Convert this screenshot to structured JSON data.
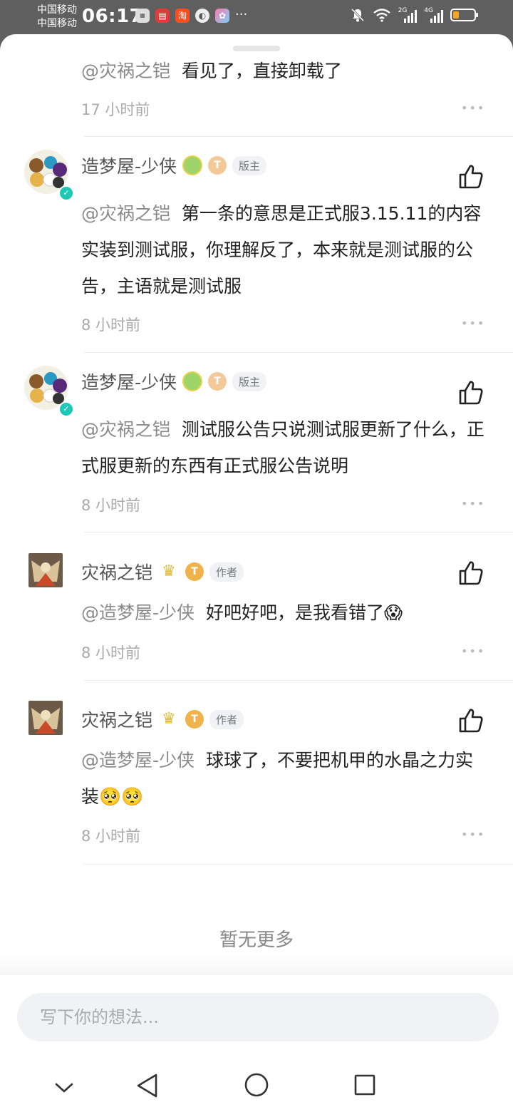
{
  "status_bar": {
    "carrier1": "中国移动",
    "carrier2": "中国移动",
    "time": "06:17",
    "net1": "2G",
    "net2": "4G",
    "dots": "···"
  },
  "comments": [
    {
      "mention": "@灾祸之铠",
      "text": "看见了，直接卸载了",
      "time": "17 小时前"
    },
    {
      "name": "造梦屋-少侠",
      "tag": "版主",
      "mention": "@灾祸之铠",
      "text": "第一条的意思是正式服3.15.11的内容实装到测试服，你理解反了，本来就是测试服的公告，主语就是测试服",
      "time": "8 小时前"
    },
    {
      "name": "造梦屋-少侠",
      "tag": "版主",
      "mention": "@灾祸之铠",
      "text": "测试服公告只说测试服更新了什么，正式服更新的东西有正式服公告说明",
      "time": "8 小时前"
    },
    {
      "name": "灾祸之铠",
      "tag": "作者",
      "mention": "@造梦屋-少侠",
      "text": "好吧好吧，是我看错了😱",
      "time": "8 小时前"
    },
    {
      "name": "灾祸之铠",
      "tag": "作者",
      "mention": "@造梦屋-少侠",
      "text": "球球了，不要把机甲的水晶之力实装🥺🥺",
      "time": "8 小时前"
    }
  ],
  "footer": {
    "no_more": "暂无更多",
    "input_placeholder": "写下你的想法..."
  },
  "badge_letter": "T",
  "more_glyph": "•••",
  "icons": {
    "like": "thumbs-up-icon",
    "more": "more-dots-icon",
    "verified": "verified-check-icon",
    "nav": [
      "chevron-down-icon",
      "back-triangle-icon",
      "home-circle-icon",
      "recents-square-icon"
    ]
  },
  "colors": {
    "verified": "#1fc7b6",
    "mention": "#8a8a8a",
    "time": "#aaaaaa"
  }
}
